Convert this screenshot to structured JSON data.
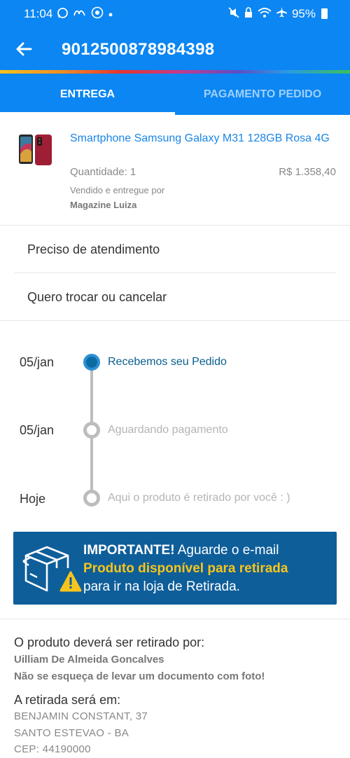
{
  "status_bar": {
    "time": "11:04",
    "battery": "95%"
  },
  "app_bar": {
    "title": "9012500878984398"
  },
  "tabs": [
    {
      "label": "ENTREGA",
      "active": true
    },
    {
      "label": "PAGAMENTO PEDIDO",
      "active": false
    }
  ],
  "product": {
    "name": "Smartphone Samsung Galaxy M31 128GB Rosa 4G",
    "quantity": "Quantidade: 1",
    "price": "R$ 1.358,40",
    "sold_by_label": "Vendido e entregue por",
    "seller": "Magazine Luiza"
  },
  "options": [
    {
      "label": "Preciso de atendimento"
    },
    {
      "label": "Quero trocar ou cancelar"
    }
  ],
  "timeline": [
    {
      "date": "05/jan",
      "text": "Recebemos seu Pedido",
      "status": "done"
    },
    {
      "date": "05/jan",
      "text": "Aguardando pagamento",
      "status": "pending"
    },
    {
      "date": "Hoje",
      "text": "Aqui o produto é retirado por você : )",
      "status": "pending"
    }
  ],
  "banner": {
    "important": "IMPORTANTE!",
    "line1_rest": " Aguarde o e-mail",
    "line2": "Produto disponível para retirada",
    "line3": "para ir na loja de Retirada."
  },
  "pickup": {
    "by_label": "O produto deverá ser retirado por:",
    "person": "Uilliam De Almeida Goncalves",
    "reminder": "Não se esqueça de levar um documento com foto!",
    "where_label": "A retirada será em:",
    "address_line1": "BENJAMIN CONSTANT, 37",
    "address_line2": "SANTO ESTEVAO - BA",
    "cep": "CEP: 44190000"
  },
  "colors": {
    "primary": "#0b86f2",
    "banner_bg": "#0e5e9a",
    "banner_highlight": "#f7c51b",
    "product_link": "#1a86e6"
  },
  "icons": [
    "whatsapp-icon",
    "notification-icon",
    "badge-icon",
    "mute-icon",
    "lock-icon",
    "wifi-icon",
    "airplane-icon",
    "battery-icon",
    "back-arrow-icon",
    "box-warning-icon"
  ]
}
